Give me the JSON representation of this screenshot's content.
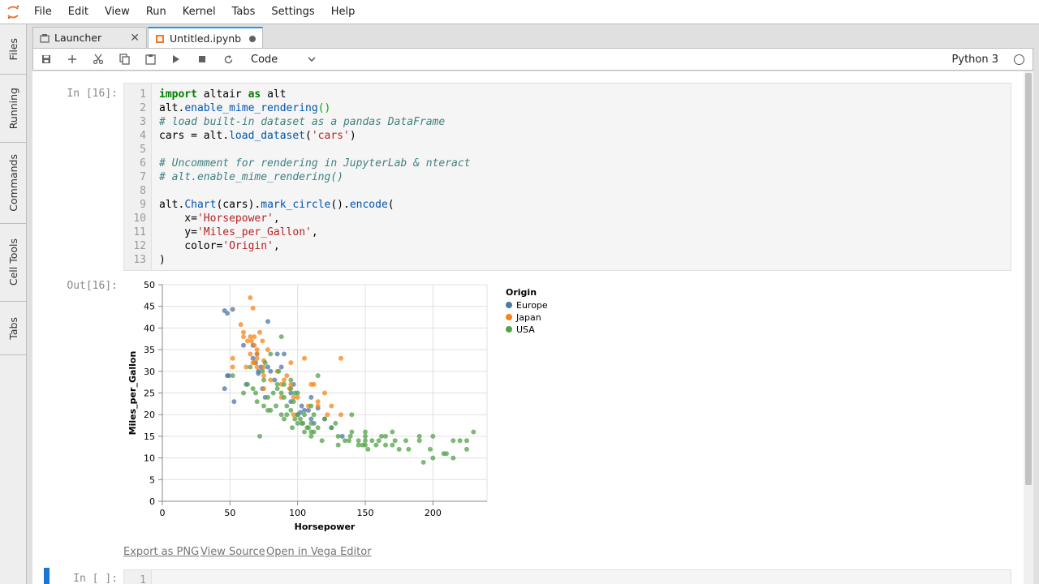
{
  "menubar": {
    "items": [
      "File",
      "Edit",
      "View",
      "Run",
      "Kernel",
      "Tabs",
      "Settings",
      "Help"
    ]
  },
  "sidebar": {
    "tabs": [
      "Files",
      "Running",
      "Commands",
      "Cell Tools",
      "Tabs"
    ]
  },
  "tabs": [
    {
      "label": "Launcher",
      "status_icon": "close-icon"
    },
    {
      "label": "Untitled.ipynb",
      "status_icon": "unsaved-dot-icon"
    }
  ],
  "toolbar": {
    "icons": [
      "save-icon",
      "add-icon",
      "cut-icon",
      "copy-icon",
      "paste-icon",
      "run-icon",
      "stop-icon",
      "restart-icon"
    ],
    "cell_type": "Code",
    "kernel_name": "Python 3"
  },
  "cell": {
    "in_prompt": "In [16]:",
    "out_prompt": "Out[16]:",
    "line_numbers": [
      "1",
      "2",
      "3",
      "4",
      "5",
      "6",
      "7",
      "8",
      "9",
      "10",
      "11",
      "12",
      "13"
    ]
  },
  "next_cell": {
    "prompt": "In [ ]:",
    "line_number": "1"
  },
  "output_links": [
    "Export as PNG",
    "View Source",
    "Open in Vega Editor"
  ],
  "chart_data": {
    "type": "scatter",
    "xlabel": "Horsepower",
    "ylabel": "Miles_per_Gallon",
    "xlim": [
      0,
      240
    ],
    "ylim": [
      0,
      50
    ],
    "xticks": [
      0,
      50,
      100,
      150,
      200
    ],
    "yticks": [
      0,
      5,
      10,
      15,
      20,
      25,
      30,
      35,
      40,
      45,
      50
    ],
    "grid": true,
    "legend": {
      "title": "Origin",
      "placement": "right"
    },
    "series": [
      {
        "name": "Europe",
        "color": "#4c78a8",
        "points": [
          [
            46,
            44
          ],
          [
            48,
            43.4
          ],
          [
            52,
            44.3
          ],
          [
            46,
            26
          ],
          [
            49,
            29
          ],
          [
            53,
            23
          ],
          [
            60,
            36
          ],
          [
            62,
            27
          ],
          [
            67,
            33
          ],
          [
            69,
            32
          ],
          [
            71,
            30
          ],
          [
            71,
            29.5
          ],
          [
            74,
            26
          ],
          [
            76,
            24
          ],
          [
            78,
            31
          ],
          [
            78,
            41.5
          ],
          [
            80,
            30
          ],
          [
            83,
            28
          ],
          [
            88,
            31
          ],
          [
            90,
            34
          ],
          [
            95,
            23
          ],
          [
            97,
            27
          ],
          [
            102,
            20.5
          ],
          [
            103,
            22
          ],
          [
            110,
            19
          ],
          [
            110,
            24
          ],
          [
            112,
            18
          ],
          [
            115,
            21.5
          ],
          [
            120,
            19
          ],
          [
            125,
            17
          ],
          [
            133,
            15
          ],
          [
            67,
            36
          ],
          [
            85,
            34
          ],
          [
            100,
            20
          ],
          [
            105,
            21
          ],
          [
            73,
            31
          ],
          [
            70,
            34
          ],
          [
            95,
            25
          ],
          [
            108,
            21
          ],
          [
            48,
            29
          ]
        ]
      },
      {
        "name": "Japan",
        "color": "#f58518",
        "points": [
          [
            65,
            47
          ],
          [
            67,
            44.6
          ],
          [
            60,
            39
          ],
          [
            58,
            40.8
          ],
          [
            65,
            38
          ],
          [
            66,
            37
          ],
          [
            68,
            36
          ],
          [
            70,
            35
          ],
          [
            72,
            39
          ],
          [
            74,
            37
          ],
          [
            65,
            34
          ],
          [
            68,
            32
          ],
          [
            70,
            33
          ],
          [
            62,
            31
          ],
          [
            67,
            32
          ],
          [
            70,
            31
          ],
          [
            75,
            31
          ],
          [
            75,
            29
          ],
          [
            75,
            26
          ],
          [
            80,
            28
          ],
          [
            88,
            27
          ],
          [
            90,
            28
          ],
          [
            92,
            29
          ],
          [
            95,
            27
          ],
          [
            97,
            24
          ],
          [
            97,
            20
          ],
          [
            100,
            24
          ],
          [
            105,
            33
          ],
          [
            110,
            27
          ],
          [
            115,
            22
          ],
          [
            115,
            23
          ],
          [
            120,
            25
          ],
          [
            122,
            20
          ],
          [
            132,
            33
          ],
          [
            52,
            33
          ],
          [
            52,
            31
          ],
          [
            60,
            38
          ],
          [
            63,
            37
          ],
          [
            68,
            38
          ],
          [
            70,
            34
          ],
          [
            75,
            32.5
          ],
          [
            78,
            35
          ],
          [
            85,
            30
          ],
          [
            88,
            24
          ],
          [
            94,
            26
          ],
          [
            95,
            32
          ],
          [
            108,
            22
          ],
          [
            112,
            27
          ],
          [
            125,
            22
          ],
          [
            132,
            20
          ]
        ]
      },
      {
        "name": "USA",
        "color": "#54a24b",
        "points": [
          [
            52,
            29
          ],
          [
            60,
            25
          ],
          [
            63,
            27
          ],
          [
            65,
            31
          ],
          [
            67,
            26
          ],
          [
            69,
            25
          ],
          [
            70,
            23
          ],
          [
            72,
            15
          ],
          [
            75,
            22
          ],
          [
            75,
            28
          ],
          [
            78,
            24
          ],
          [
            80,
            21
          ],
          [
            80,
            34
          ],
          [
            84,
            22
          ],
          [
            85,
            26
          ],
          [
            86,
            30
          ],
          [
            88,
            38
          ],
          [
            88,
            20
          ],
          [
            90,
            24
          ],
          [
            90,
            27
          ],
          [
            90,
            19
          ],
          [
            92,
            22
          ],
          [
            95,
            28
          ],
          [
            95,
            26
          ],
          [
            97,
            23
          ],
          [
            98,
            19
          ],
          [
            100,
            18
          ],
          [
            100,
            20
          ],
          [
            100,
            25
          ],
          [
            103,
            18
          ],
          [
            105,
            20
          ],
          [
            105,
            16
          ],
          [
            107,
            17
          ],
          [
            110,
            16
          ],
          [
            110,
            18
          ],
          [
            110,
            22
          ],
          [
            110,
            15
          ],
          [
            112,
            20
          ],
          [
            115,
            17
          ],
          [
            115,
            29
          ],
          [
            120,
            19
          ],
          [
            125,
            17
          ],
          [
            130,
            13
          ],
          [
            130,
            15
          ],
          [
            135,
            14
          ],
          [
            139,
            15
          ],
          [
            140,
            16
          ],
          [
            140,
            20
          ],
          [
            145,
            14
          ],
          [
            145,
            13
          ],
          [
            150,
            13
          ],
          [
            150,
            15
          ],
          [
            150,
            14
          ],
          [
            150,
            16
          ],
          [
            152,
            12
          ],
          [
            155,
            14
          ],
          [
            158,
            13
          ],
          [
            160,
            14
          ],
          [
            165,
            13
          ],
          [
            165,
            15
          ],
          [
            170,
            13
          ],
          [
            170,
            16
          ],
          [
            175,
            12
          ],
          [
            180,
            14
          ],
          [
            190,
            14
          ],
          [
            193,
            9
          ],
          [
            198,
            12
          ],
          [
            200,
            10
          ],
          [
            208,
            11
          ],
          [
            210,
            11
          ],
          [
            215,
            10
          ],
          [
            215,
            14
          ],
          [
            220,
            14
          ],
          [
            225,
            12
          ],
          [
            225,
            14
          ],
          [
            230,
            16
          ],
          [
            74,
            30
          ],
          [
            76,
            32
          ],
          [
            82,
            25
          ],
          [
            85,
            27
          ],
          [
            92,
            20
          ],
          [
            95,
            21
          ],
          [
            98,
            25
          ],
          [
            102,
            19
          ],
          [
            108,
            17
          ],
          [
            118,
            14
          ],
          [
            128,
            18
          ],
          [
            138,
            14
          ],
          [
            148,
            13
          ],
          [
            162,
            15
          ],
          [
            172,
            14
          ],
          [
            182,
            12
          ],
          [
            190,
            15
          ],
          [
            200,
            15
          ],
          [
            78,
            21
          ],
          [
            88,
            25
          ],
          [
            96,
            17
          ],
          [
            104,
            18
          ],
          [
            112,
            16
          ]
        ]
      }
    ]
  }
}
